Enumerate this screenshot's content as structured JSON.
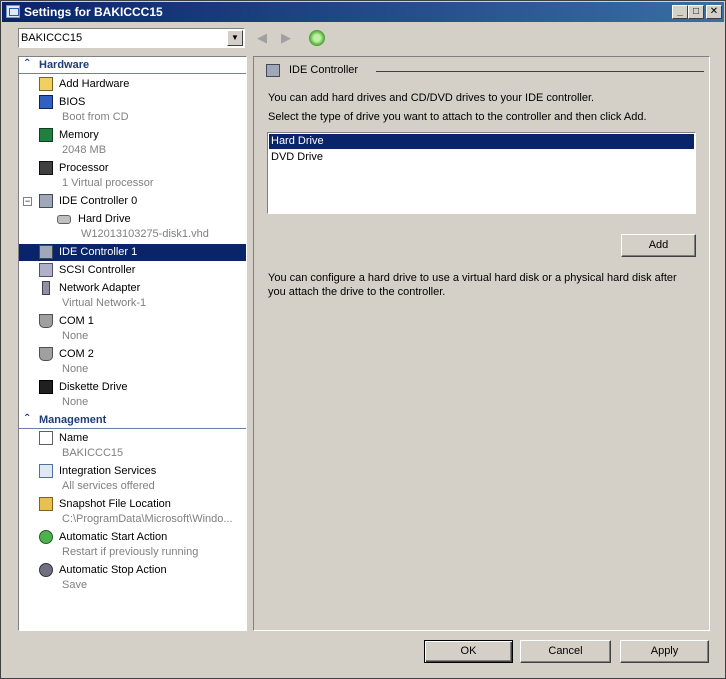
{
  "window": {
    "title": "Settings for BAKICCC15"
  },
  "vm_selector": {
    "value": "BAKICCC15"
  },
  "hardware": {
    "heading": "Hardware",
    "items": [
      {
        "label": "Add Hardware"
      },
      {
        "label": "BIOS",
        "sub": "Boot from CD"
      },
      {
        "label": "Memory",
        "sub": "2048 MB"
      },
      {
        "label": "Processor",
        "sub": "1 Virtual processor"
      },
      {
        "label": "IDE Controller 0"
      },
      {
        "label": "Hard Drive",
        "sub": "W12013103275-disk1.vhd"
      },
      {
        "label": "IDE Controller 1"
      },
      {
        "label": "SCSI Controller"
      },
      {
        "label": "Network Adapter",
        "sub": "Virtual Network-1"
      },
      {
        "label": "COM 1",
        "sub": "None"
      },
      {
        "label": "COM 2",
        "sub": "None"
      },
      {
        "label": "Diskette Drive",
        "sub": "None"
      }
    ]
  },
  "management": {
    "heading": "Management",
    "items": [
      {
        "label": "Name",
        "sub": "BAKICCC15"
      },
      {
        "label": "Integration Services",
        "sub": "All services offered"
      },
      {
        "label": "Snapshot File Location",
        "sub": "C:\\ProgramData\\Microsoft\\Windo..."
      },
      {
        "label": "Automatic Start Action",
        "sub": "Restart if previously running"
      },
      {
        "label": "Automatic Stop Action",
        "sub": "Save"
      }
    ]
  },
  "panel": {
    "title": "IDE Controller",
    "intro": "You can add hard drives and CD/DVD drives to your IDE controller.",
    "instruction": "Select the type of drive you want to attach to the controller and then click Add.",
    "drive_types": [
      "Hard Drive",
      "DVD Drive"
    ],
    "selected_drive": "Hard Drive",
    "add_label": "Add",
    "note_line1": "You can configure a hard drive to use a virtual hard disk or a physical hard disk after",
    "note_line2": "you attach the drive to the controller."
  },
  "footer": {
    "ok": "OK",
    "cancel": "Cancel",
    "apply": "Apply"
  },
  "colors": {
    "selection": "#0a246a",
    "titlebar": "#0a246a",
    "face": "#d4d0c8"
  }
}
